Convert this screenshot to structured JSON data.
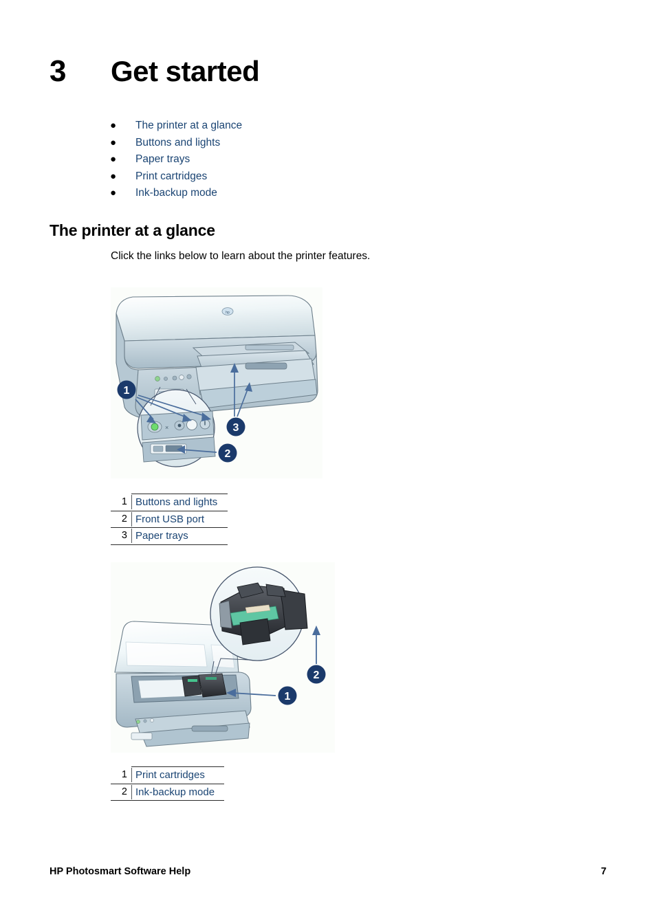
{
  "document": {
    "chapter_number": "3",
    "chapter_title": "Get started"
  },
  "toc_links": [
    {
      "bullet": "●",
      "label": "The printer at a glance"
    },
    {
      "bullet": "●",
      "label": "Buttons and lights"
    },
    {
      "bullet": "●",
      "label": "Paper trays"
    },
    {
      "bullet": "●",
      "label": "Print cartridges"
    },
    {
      "bullet": "●",
      "label": "Ink-backup mode"
    }
  ],
  "section": {
    "heading": "The printer at a glance",
    "intro": "Click the links below to learn about the printer features."
  },
  "figure_front": {
    "alt": "HP Deskjet printer front view with output tray extended and magnified inset of the control panel",
    "callouts": [
      "1",
      "2",
      "3"
    ]
  },
  "legend_front": {
    "rows": [
      {
        "num": "1",
        "label": "Buttons and lights"
      },
      {
        "num": "2",
        "label": "Front USB port"
      },
      {
        "num": "3",
        "label": "Paper trays"
      }
    ]
  },
  "figure_open": {
    "alt": "HP Deskjet printer with top cover raised showing print cartridge cradle and magnified inset of the print cartridges",
    "callouts": [
      "1",
      "2"
    ]
  },
  "legend_open": {
    "rows": [
      {
        "num": "1",
        "label": "Print cartridges"
      },
      {
        "num": "2",
        "label": "Ink-backup mode"
      }
    ]
  },
  "footer": {
    "title": "HP Photosmart Software Help",
    "page_number": "7"
  },
  "colors": {
    "link": "#1a4473",
    "callout_circle": "#1b3a6b",
    "callout_text": "#ffffff",
    "printer_body": "#c5d3dc",
    "printer_lid": "#eef4f6",
    "arrow": "#4a6d9c",
    "rule": "#2b2b2b",
    "figure_background": "#fbfdfa"
  }
}
